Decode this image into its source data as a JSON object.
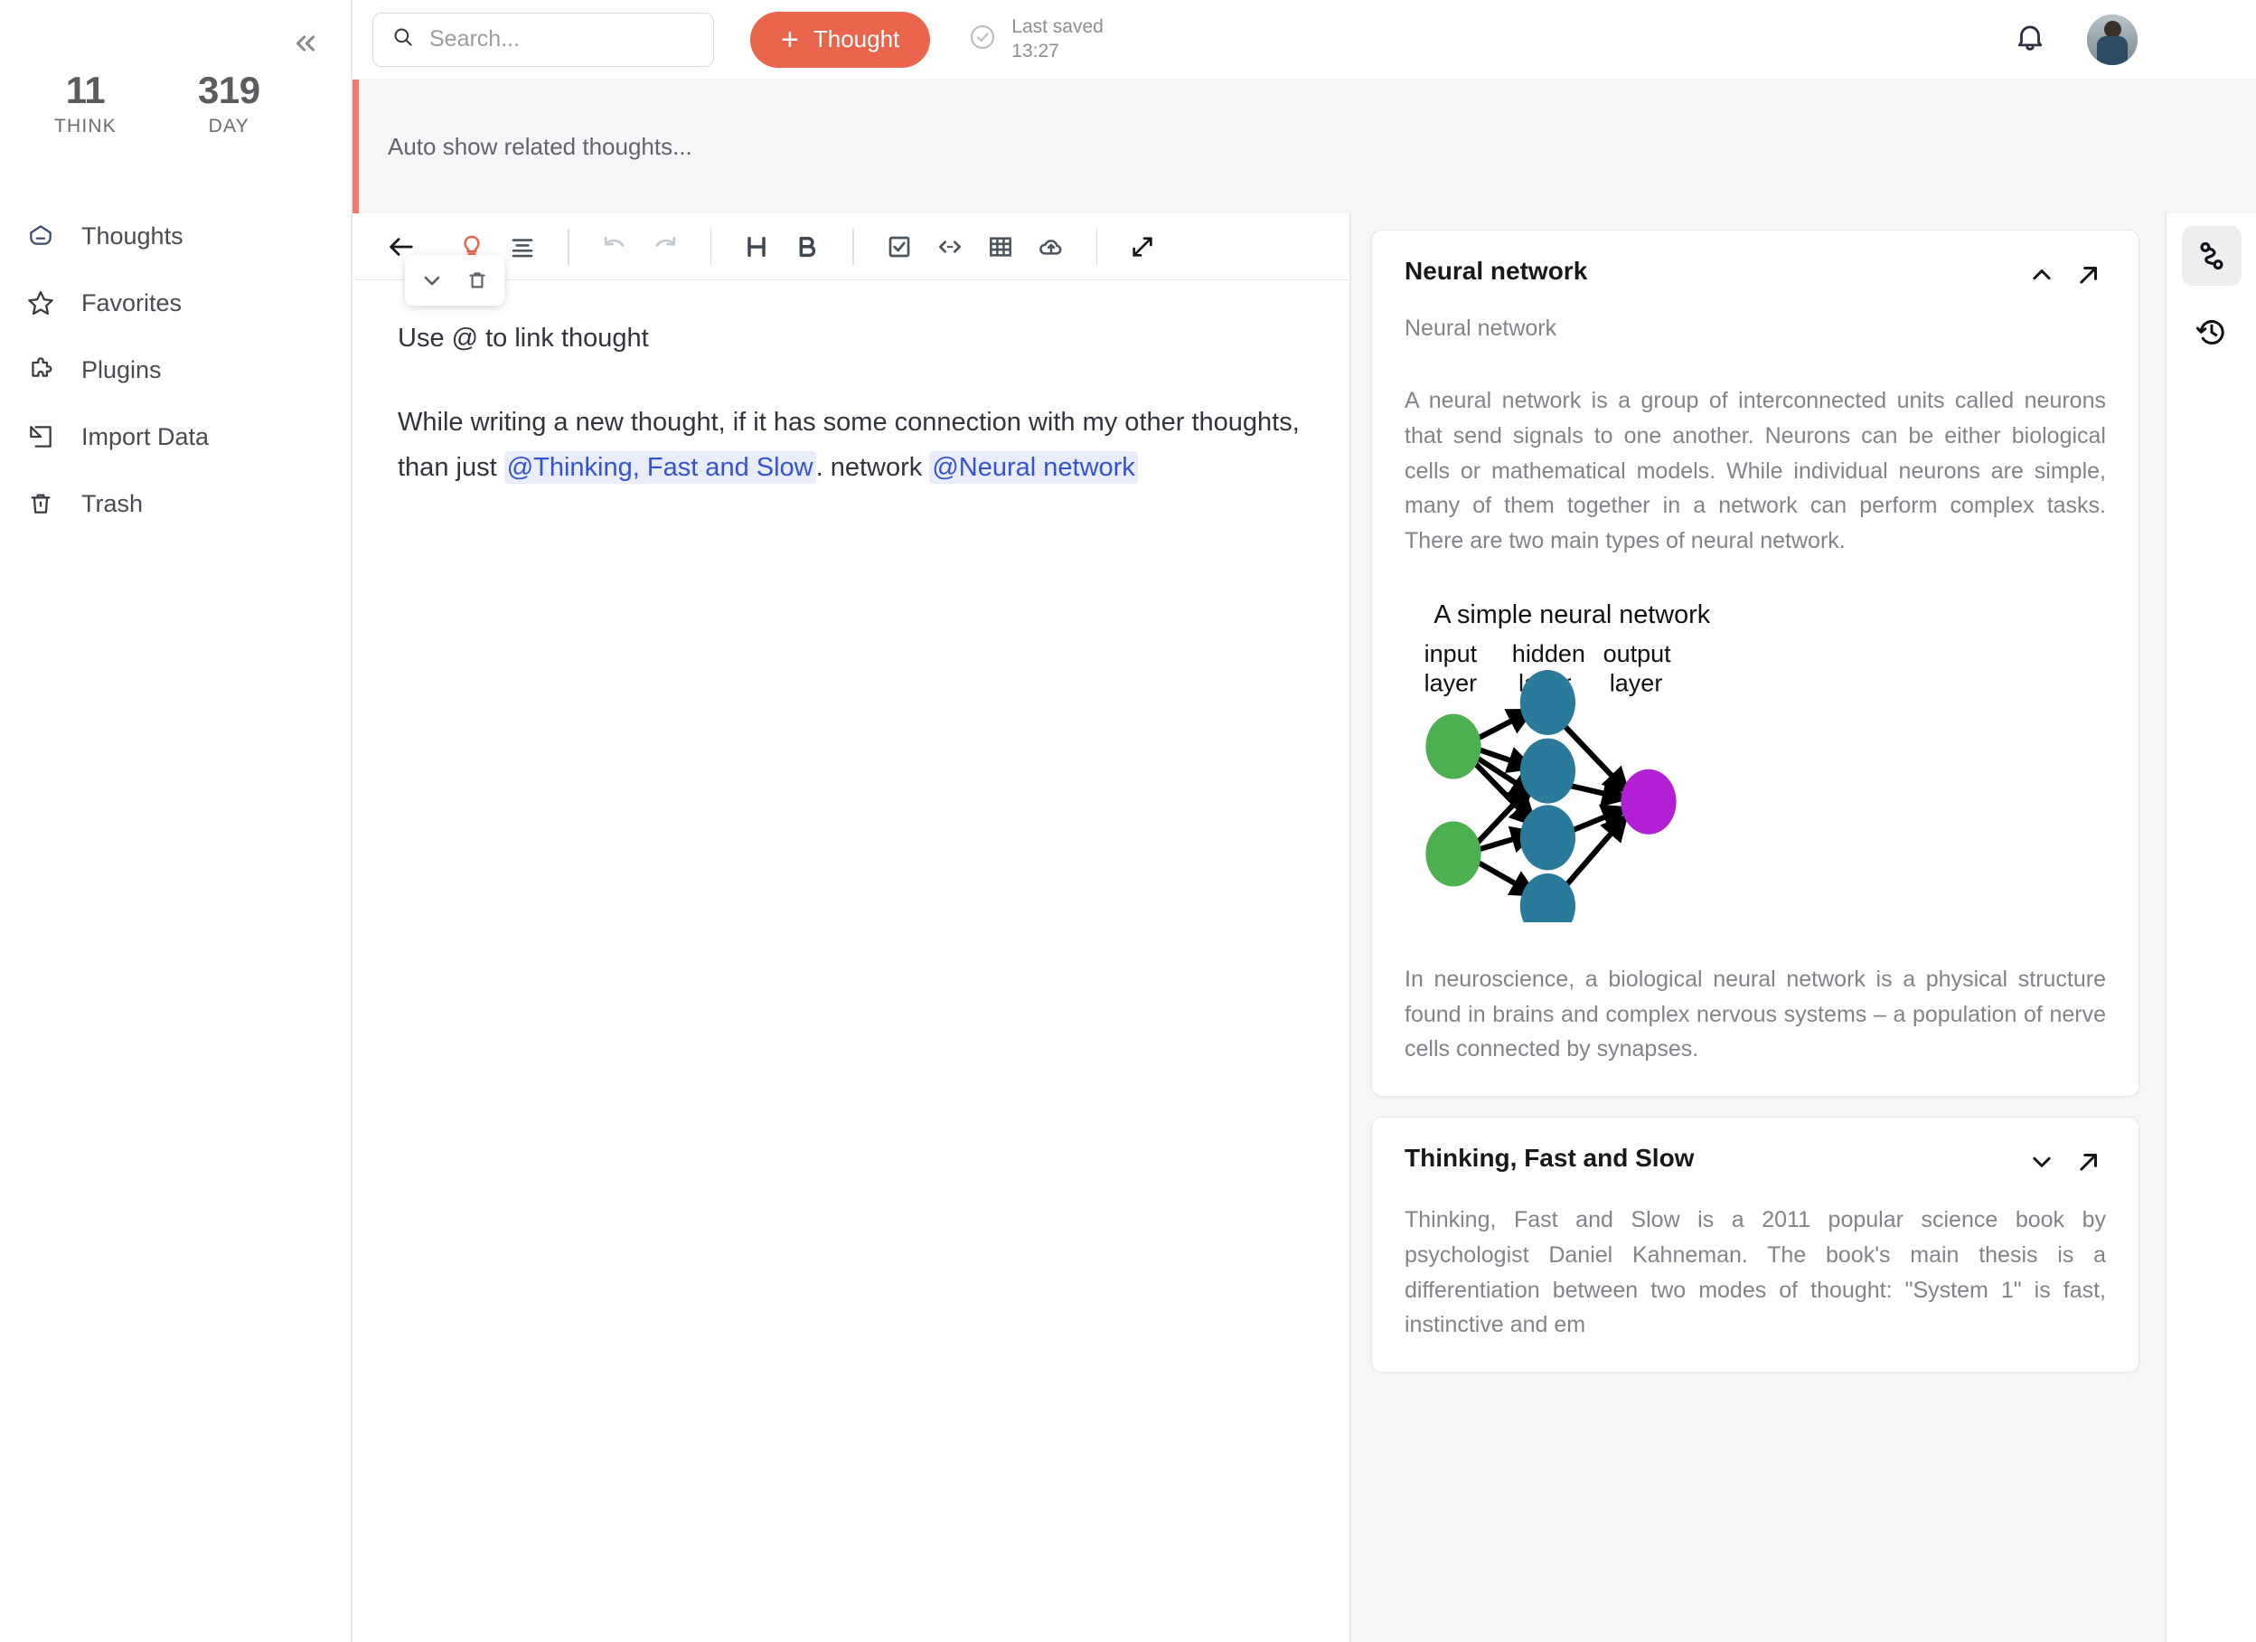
{
  "sidebar": {
    "collapse_icon": "chevrons-left-icon",
    "stats": [
      {
        "value": "11",
        "label": "THINK"
      },
      {
        "value": "319",
        "label": "DAY"
      }
    ],
    "items": [
      {
        "label": "Thoughts",
        "icon": "thought-bubble-icon"
      },
      {
        "label": "Favorites",
        "icon": "star-icon"
      },
      {
        "label": "Plugins",
        "icon": "puzzle-icon"
      },
      {
        "label": "Import Data",
        "icon": "import-arrow-icon"
      },
      {
        "label": "Trash",
        "icon": "trash-icon"
      }
    ]
  },
  "topbar": {
    "search": {
      "placeholder": "Search...",
      "value": "",
      "icon": "search-icon"
    },
    "new_thought_button": {
      "label": "Thought",
      "plus": "+",
      "color": "#e8644a"
    },
    "saved": {
      "icon": "check-circle-icon",
      "line1": "Last saved",
      "line2": "13:27"
    },
    "bell_icon": "bell-icon",
    "avatar": "user-avatar"
  },
  "banner": {
    "text": "Auto show related thoughts...",
    "accent_color": "#ea7b69"
  },
  "editor": {
    "toolbar": [
      {
        "name": "back-arrow-icon",
        "state": "normal"
      },
      {
        "name": "lightbulb-icon",
        "state": "accent"
      },
      {
        "name": "align-text-icon",
        "state": "normal"
      },
      {
        "name": "undo-icon",
        "state": "disabled"
      },
      {
        "name": "redo-icon",
        "state": "disabled"
      },
      {
        "name": "heading-icon",
        "state": "normal",
        "glyph": "H"
      },
      {
        "name": "bold-icon",
        "state": "normal",
        "glyph": "B"
      },
      {
        "name": "checkbox-icon",
        "state": "normal"
      },
      {
        "name": "code-icon",
        "state": "normal"
      },
      {
        "name": "table-icon",
        "state": "normal"
      },
      {
        "name": "cloud-upload-icon",
        "state": "normal"
      },
      {
        "name": "expand-fullscreen-icon",
        "state": "normal"
      }
    ],
    "float_actions": [
      {
        "name": "chevron-down-icon"
      },
      {
        "name": "trash-icon"
      }
    ],
    "title_line": "Use @ to link thought",
    "paragraph": {
      "part1": "While writing a new thought, if it has some connection with my other thoughts, than just ",
      "mention1": "@Thinking, Fast and Slow",
      "part2": ". network ",
      "mention2": "@Neural network"
    }
  },
  "related": {
    "cards": [
      {
        "title": "Neural network",
        "subtitle": "Neural network",
        "collapse_icon": "chevron-up-icon",
        "open_icon": "arrow-up-right-icon",
        "body1": "A neural network is a group of interconnected units called neurons that send signals to one another. Neurons can be either biological cells or mathematical models. While individual neurons are simple, many of them together in a network can perform complex tasks. There are two main types of neural network.",
        "figure": {
          "title": "A simple neural network",
          "labels": [
            "input layer",
            "hidden layer",
            "output layer"
          ],
          "input_nodes": 2,
          "hidden_nodes": 4,
          "output_nodes": 1,
          "colors": {
            "input": "#4caf50",
            "hidden": "#2a7a9b",
            "output": "#b31fd4"
          }
        },
        "body2": "In neuroscience, a biological neural network is a physical structure found in brains and complex nervous systems – a population of nerve cells connected by synapses."
      },
      {
        "title": "Thinking, Fast and Slow",
        "collapse_icon": "chevron-down-icon",
        "open_icon": "arrow-up-right-icon",
        "body1": "Thinking, Fast and Slow is a 2011 popular science book by psychologist Daniel Kahneman. The book's main thesis is a differentiation between two modes of thought: \"System 1\" is fast, instinctive and em"
      }
    ]
  },
  "rail": {
    "buttons": [
      {
        "name": "relations-graph-icon",
        "active": true
      },
      {
        "name": "history-clock-icon",
        "active": false
      }
    ]
  }
}
